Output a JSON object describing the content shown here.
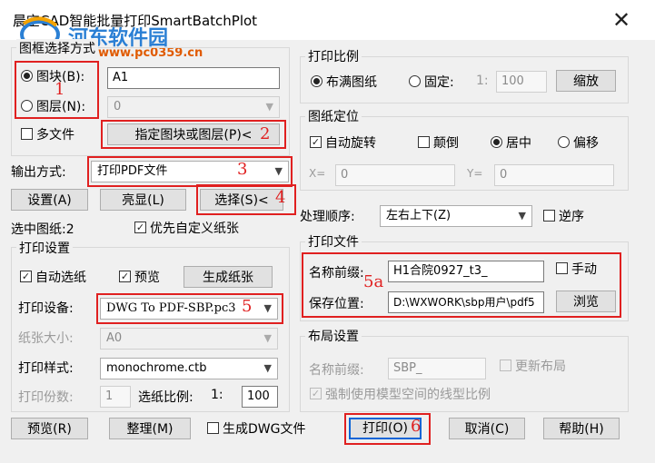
{
  "window": {
    "title": "晨空CAD智能批量打印SmartBatchPlot",
    "close_glyph": "✕"
  },
  "watermark": {
    "text": "河东软件园",
    "url": "www.pc0359.cn"
  },
  "selection": {
    "group_title": "图框选择方式",
    "block_label": "图块(B):",
    "block_value": "A1",
    "layer_label": "图层(N):",
    "layer_value": "0",
    "multi_file_label": "多文件",
    "specify_button": "指定图块或图层(P)<"
  },
  "output": {
    "label": "输出方式:",
    "value": "打印PDF文件",
    "settings_button": "设置(A)",
    "highlight_button": "亮显(L)",
    "select_button": "选择(S)<",
    "selected_count": "选中图纸:2",
    "prefer_custom_paper": "优先自定义纸张"
  },
  "print_settings": {
    "group_title": "打印设置",
    "auto_paper": "自动选纸",
    "preview": "预览",
    "generate_paper_button": "生成纸张",
    "device_label": "打印设备:",
    "device_value": "DWG To PDF-SBP.pc3",
    "paper_size_label": "纸张大小:",
    "paper_size_value": "A0",
    "style_label": "打印样式:",
    "style_value": "monochrome.ctb",
    "copies_label": "打印份数:",
    "copies_value": "1",
    "scale_label": "选纸比例:",
    "scale_prefix": "1:",
    "scale_value": "100"
  },
  "scale": {
    "group_title": "打印比例",
    "fit_label": "布满图纸",
    "fixed_label": "固定:",
    "fixed_prefix": "1:",
    "fixed_value": "100",
    "zoom_button": "缩放"
  },
  "position": {
    "group_title": "图纸定位",
    "auto_rotate": "自动旋转",
    "upside_down": "颠倒",
    "center": "居中",
    "offset": "偏移",
    "x_label": "X=",
    "x_value": "0",
    "y_label": "Y=",
    "y_value": "0"
  },
  "order": {
    "label": "处理顺序:",
    "value": "左右上下(Z)",
    "reverse": "逆序"
  },
  "print_file": {
    "group_title": "打印文件",
    "prefix_label": "名称前缀:",
    "prefix_value": "H1合院0927_t3_",
    "manual": "手动",
    "save_label": "保存位置:",
    "save_value": "D:\\WXWORK\\sbp用户\\pdf5",
    "browse_button": "浏览"
  },
  "layout": {
    "group_title": "布局设置",
    "prefix_label": "名称前缀:",
    "prefix_value": "SBP_",
    "new_layout": "更新布局",
    "force_model_linetype": "强制使用模型空间的线型比例"
  },
  "bottom": {
    "preview_button": "预览(R)",
    "arrange_button": "整理(M)",
    "gen_dwg": "生成DWG文件",
    "print_button": "打印(O)",
    "cancel_button": "取消(C)",
    "help_button": "帮助(H)"
  },
  "markers": {
    "m1": "1",
    "m2": "2",
    "m3": "3",
    "m4": "4",
    "m5": "5",
    "m5a": "5a",
    "m6": "6"
  },
  "colors": {
    "annotation": "#e02020",
    "accent": "#0a64d6",
    "background": "#f0f0f0"
  }
}
